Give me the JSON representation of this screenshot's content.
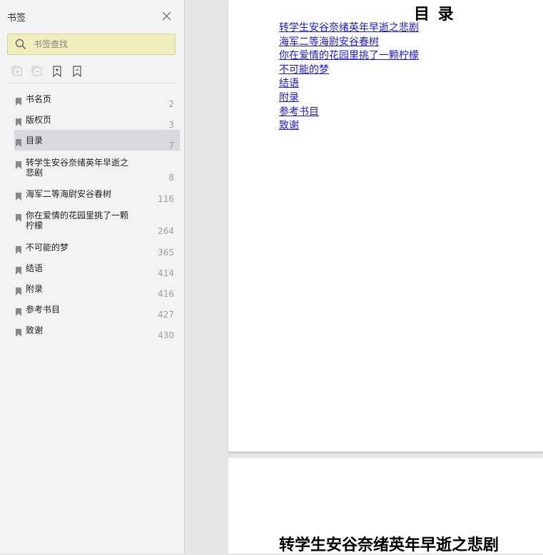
{
  "sidebar": {
    "title": "书签",
    "search_placeholder": "书签查找",
    "items": [
      {
        "label": "书名页",
        "page": "2"
      },
      {
        "label": "版权页",
        "page": "3"
      },
      {
        "label": "目录",
        "page": "7",
        "active": true
      },
      {
        "label": "转学生安谷奈绪英年早逝之悲剧",
        "page": "8"
      },
      {
        "label": "海军二等海尉安谷春树",
        "page": "116"
      },
      {
        "label": "你在爱情的花园里挑了一颗柠檬",
        "page": "264"
      },
      {
        "label": "不可能的梦",
        "page": "365"
      },
      {
        "label": "结语",
        "page": "414"
      },
      {
        "label": "附录",
        "page": "416"
      },
      {
        "label": "参考书目",
        "page": "427"
      },
      {
        "label": "致谢",
        "page": "430"
      }
    ]
  },
  "document": {
    "toc_title": "目 录",
    "toc_links": [
      "转学生安谷奈绪英年早逝之悲剧",
      "海军二等海尉安谷春树",
      "你在爱情的花园里挑了一颗柠檬",
      "不可能的梦",
      "结语",
      "附录",
      "参考书目",
      "致谢"
    ],
    "next_chapter_title": "转学生安谷奈绪英年早逝之悲剧"
  },
  "colors": {
    "search_bg": "#efeebd",
    "link": "#1a1ae0",
    "active_row": "#dadadd",
    "page_num": "#9aa0aa"
  }
}
